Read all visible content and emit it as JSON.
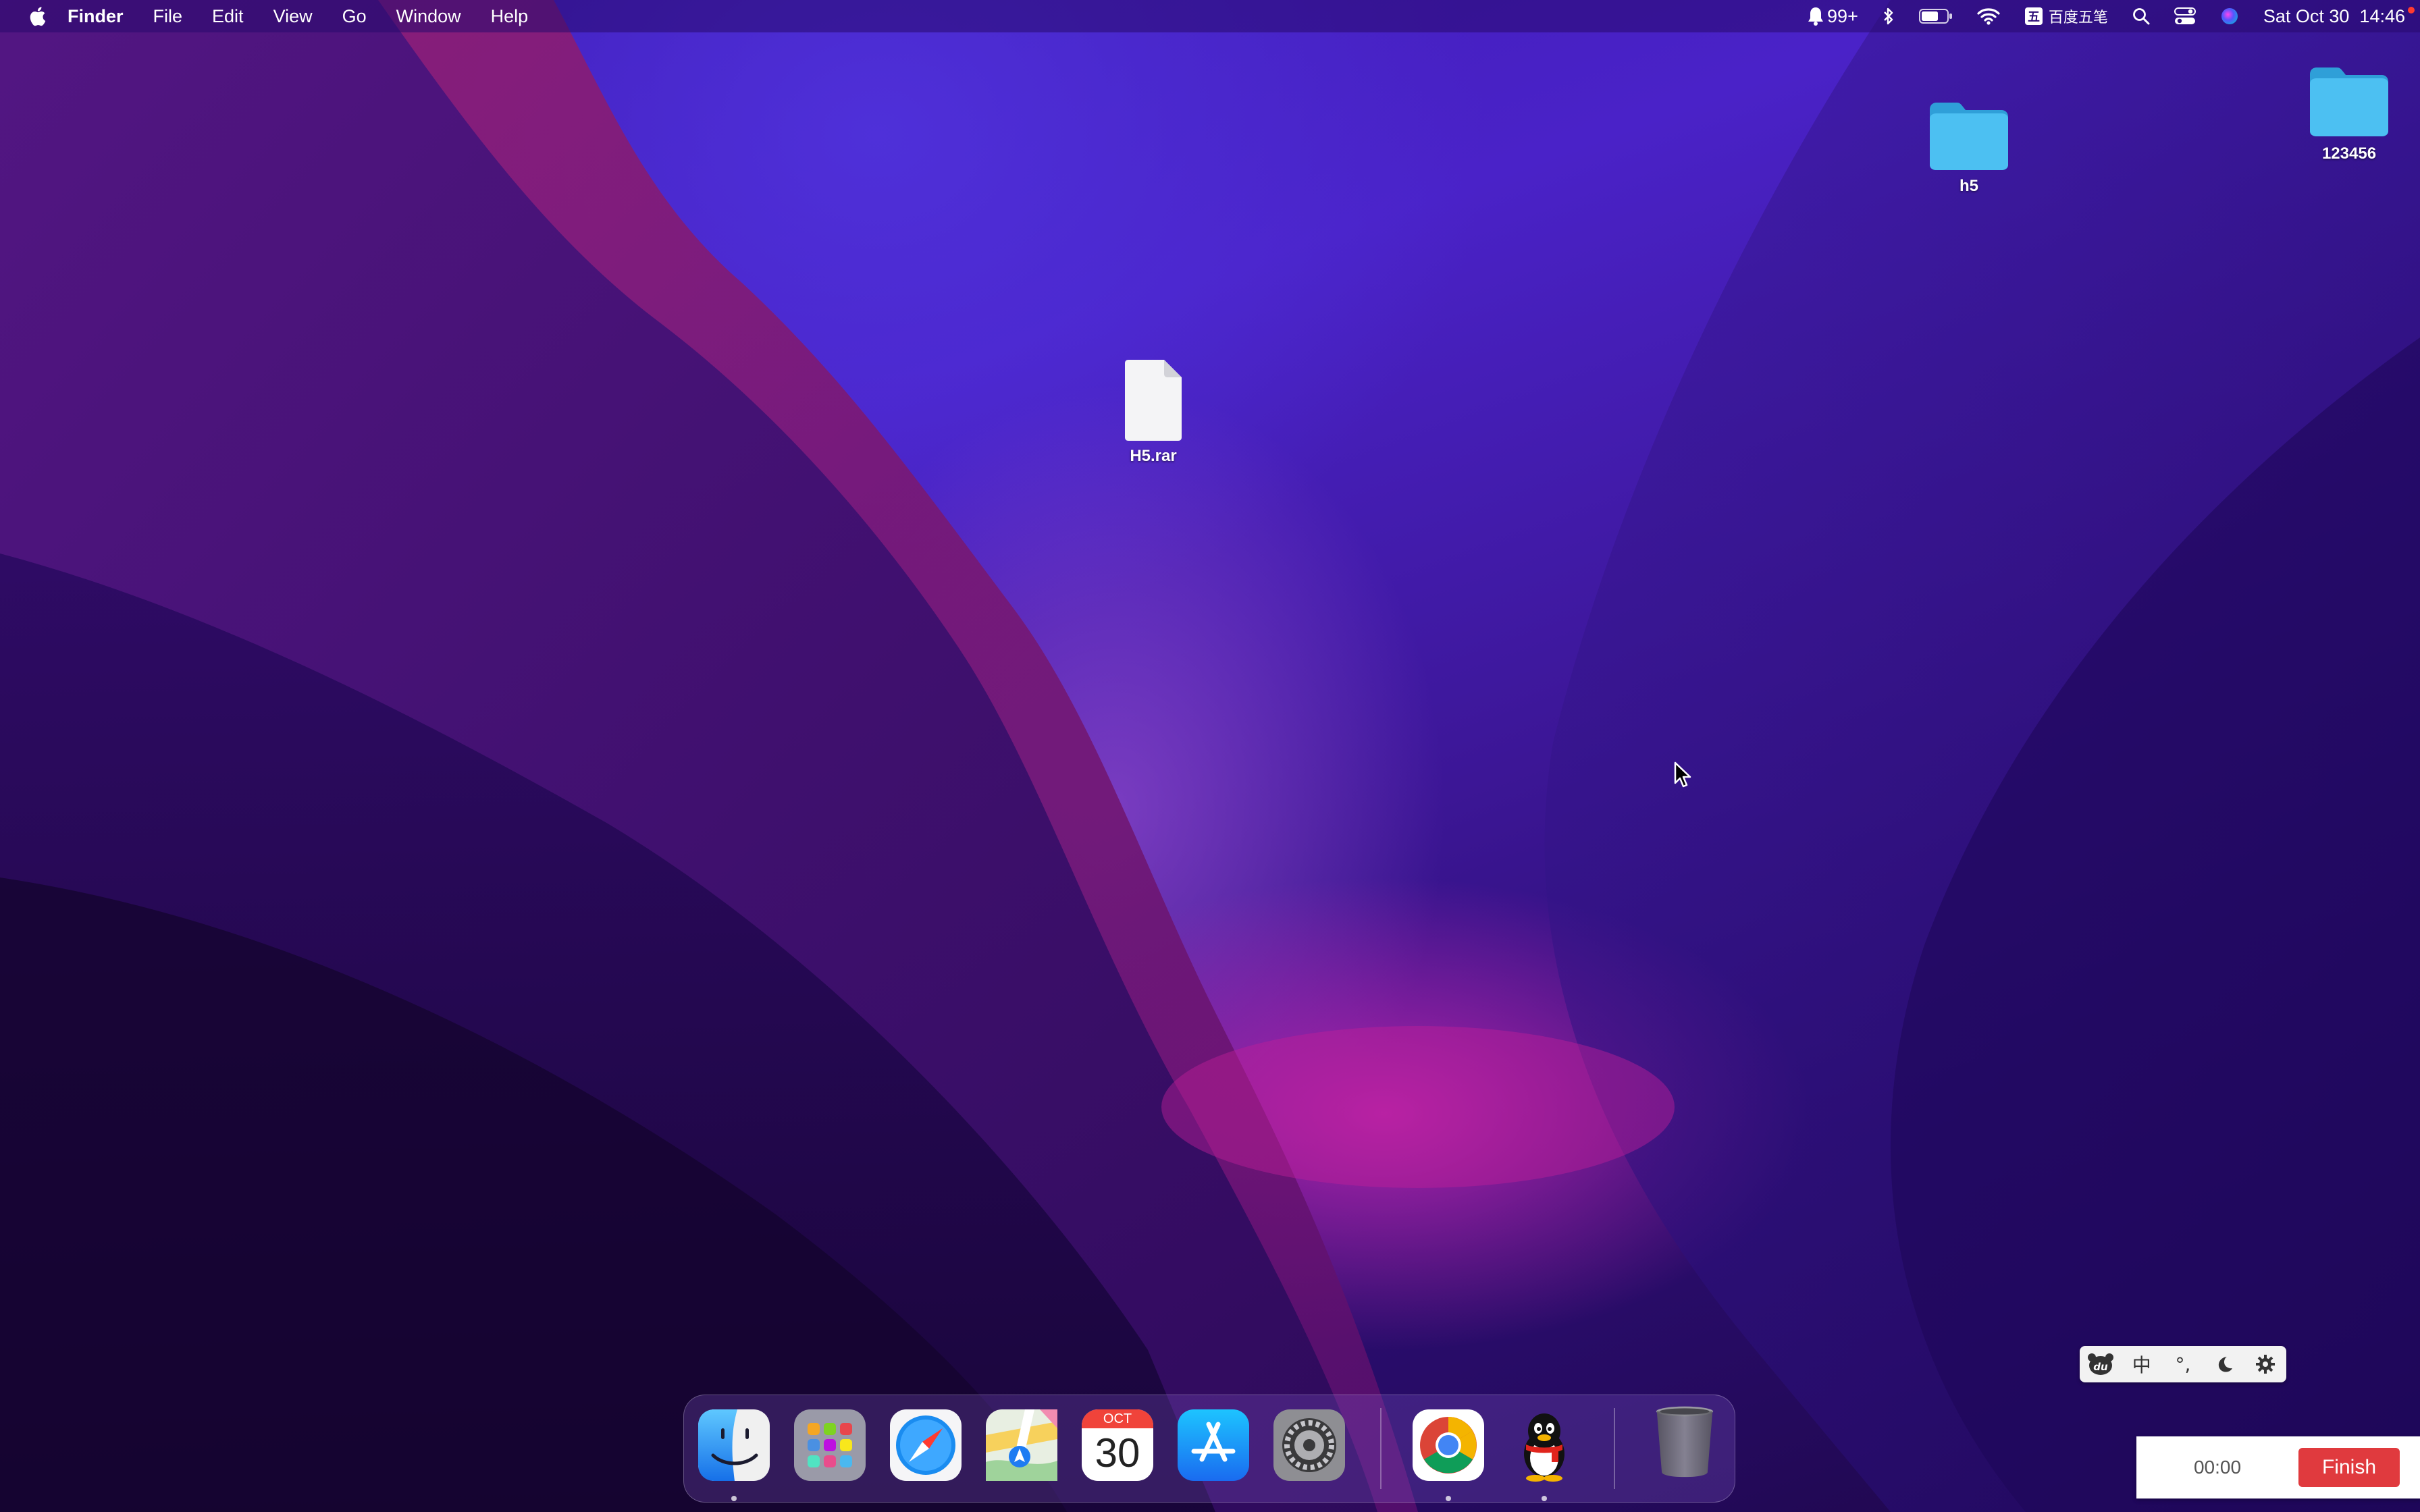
{
  "menubar": {
    "app_name": "Finder",
    "menus": [
      "File",
      "Edit",
      "View",
      "Go",
      "Window",
      "Help"
    ],
    "notification_count": "99+",
    "input_method_label": "百度五笔",
    "clock": "Sat Oct 30  14:46"
  },
  "desktop": {
    "items": [
      {
        "label": "h5",
        "icon": "folder-icon"
      },
      {
        "label": "123456",
        "icon": "folder-icon"
      },
      {
        "label": "H5.rar",
        "icon": "document-icon"
      }
    ]
  },
  "ime_toolbar": {
    "buttons": [
      "du-logo-icon",
      "中",
      "°,",
      "moon-icon",
      "gear-icon"
    ]
  },
  "timer": {
    "time": "00:00",
    "finish_label": "Finish"
  },
  "dock": {
    "apps": [
      "Finder",
      "Launchpad",
      "Safari",
      "Maps",
      "Calendar",
      "App Store",
      "System Preferences",
      "Google Chrome",
      "QQ",
      "Trash"
    ],
    "calendar_month": "OCT",
    "calendar_day": "30"
  },
  "colors": {
    "folder": "#3fb8ef",
    "finish_button": "#e03a3e",
    "menubar": "#2b0c76"
  }
}
